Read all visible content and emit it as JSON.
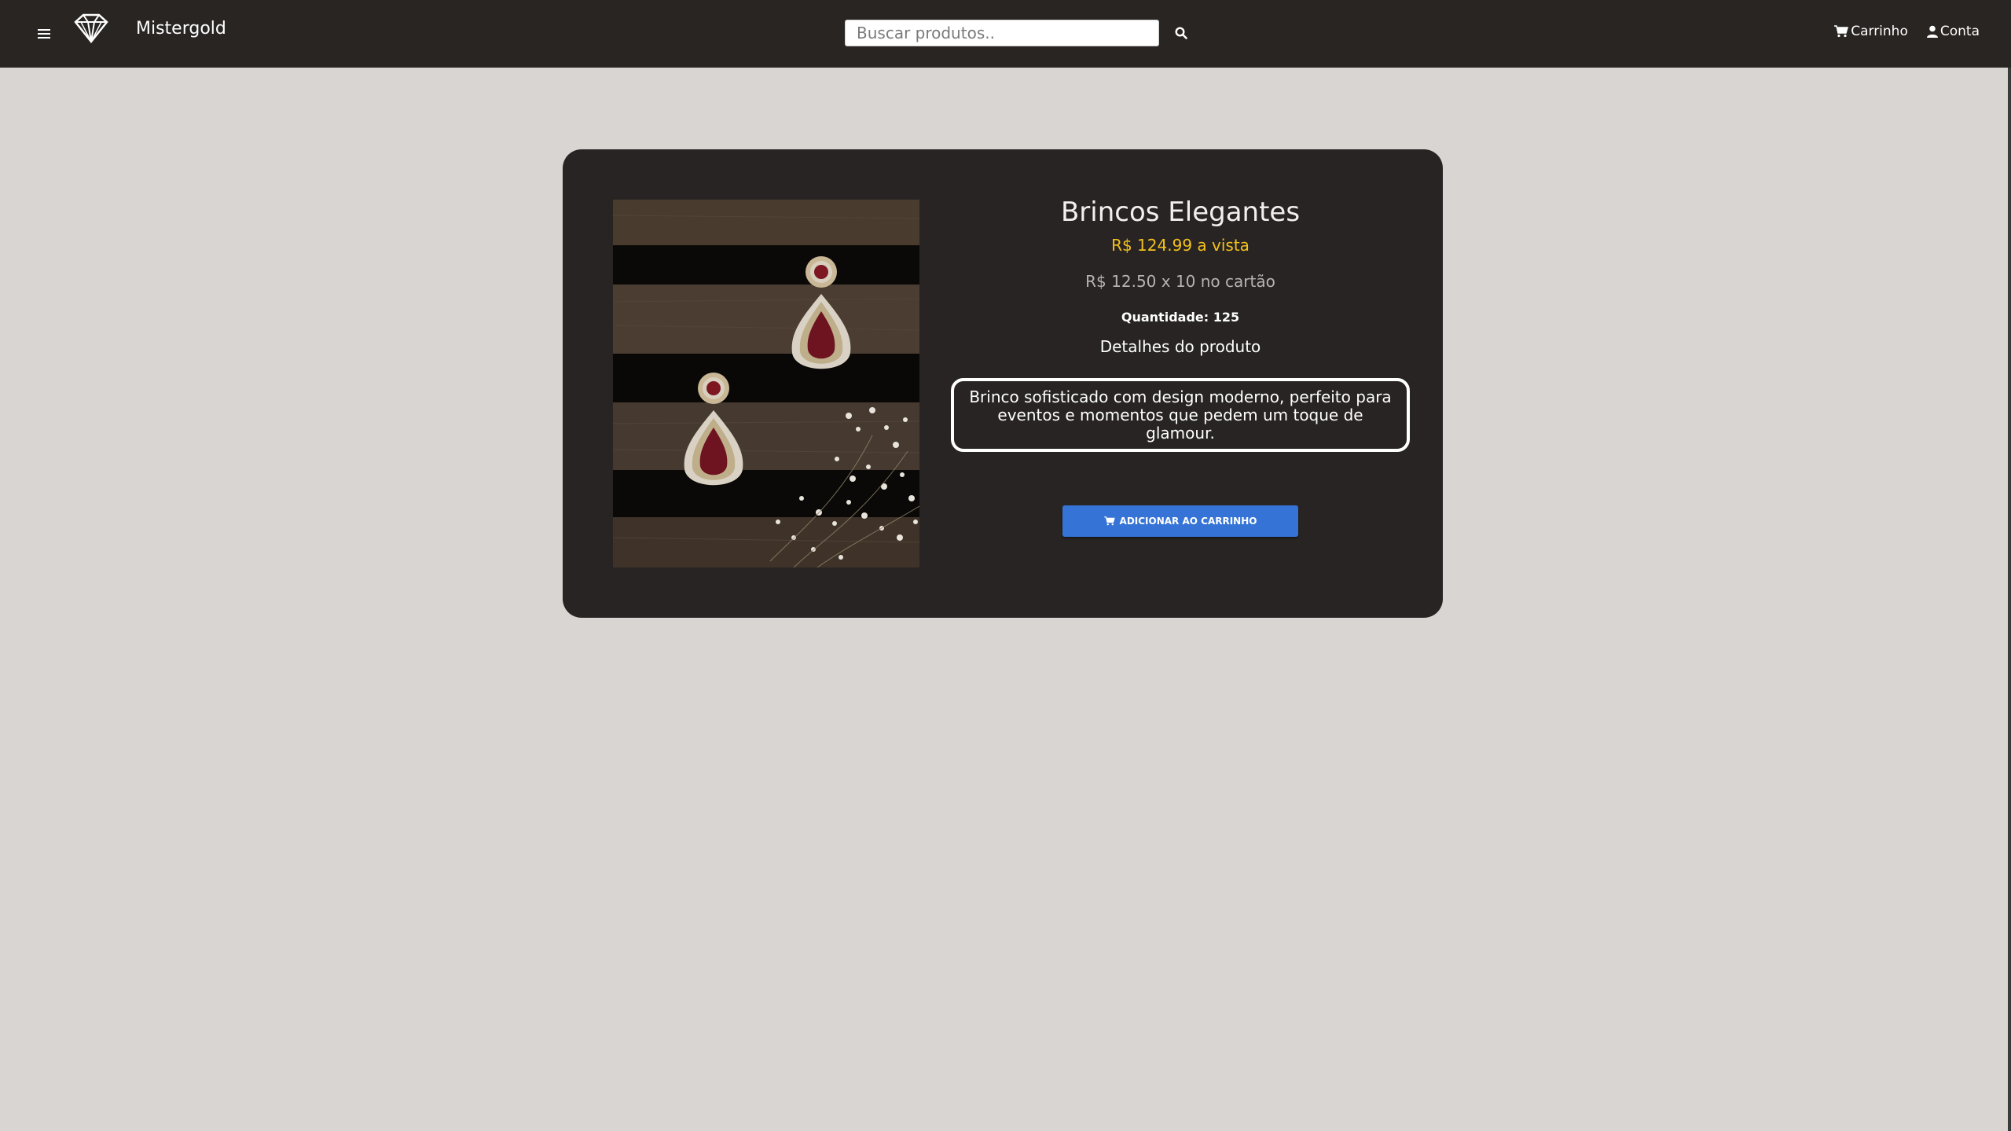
{
  "header": {
    "menu_icon": "hamburger-icon",
    "logo_icon": "diamond-icon",
    "brand": "Mistergold",
    "search": {
      "placeholder": "Buscar produtos..",
      "value": "",
      "icon": "search-icon"
    },
    "cart": {
      "label": "Carrinho",
      "icon": "cart-icon"
    },
    "account": {
      "label": "Conta",
      "icon": "user-icon"
    }
  },
  "product": {
    "name": "Brincos Elegantes",
    "price_cash": "R$ 124.99 a vista",
    "price_installments": "R$ 12.50 x 10 no cartão",
    "quantity": "Quantidade: 125",
    "details_title": "Detalhes do produto",
    "description": "Brinco sofisticado com design moderno, perfeito para eventos e momentos que pedem um toque de glamour.",
    "add_to_cart_label": "ADICIONAR AO CARRINHO"
  },
  "colors": {
    "header_bg": "#292523",
    "page_bg": "#d8d5d2",
    "card_bg": "#282423",
    "price_accent": "#f3c21d",
    "button_bg": "#3574d6"
  }
}
